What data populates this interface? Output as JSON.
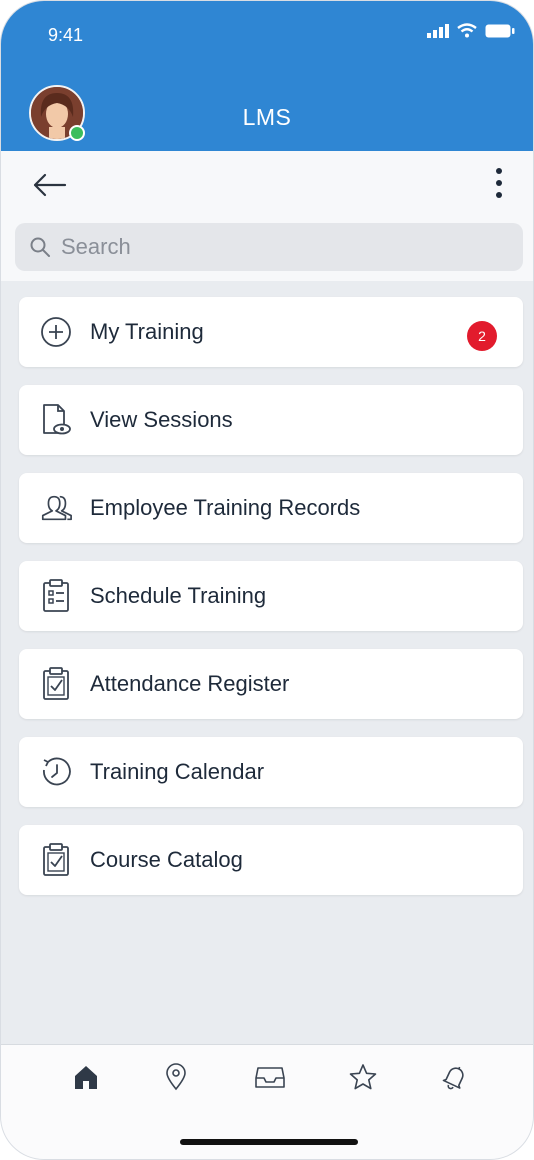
{
  "status_bar": {
    "time": "9:41"
  },
  "header": {
    "title": "LMS"
  },
  "search": {
    "placeholder": "Search"
  },
  "menu": {
    "items": [
      {
        "label": "My Training",
        "icon": "plus-circle-icon",
        "badge": "2"
      },
      {
        "label": "View Sessions",
        "icon": "document-eye-icon"
      },
      {
        "label": "Employee Training Records",
        "icon": "users-icon"
      },
      {
        "label": "Schedule Training",
        "icon": "clipboard-list-icon"
      },
      {
        "label": "Attendance Register",
        "icon": "clipboard-check-icon"
      },
      {
        "label": "Training Calendar",
        "icon": "clock-history-icon"
      },
      {
        "label": "Course Catalog",
        "icon": "clipboard-check-icon"
      }
    ]
  },
  "tabbar": {
    "tabs": [
      "home-icon",
      "location-pin-icon",
      "inbox-icon",
      "star-icon",
      "bell-icon"
    ],
    "active": "home-icon"
  },
  "colors": {
    "header": "#2f86d3",
    "badge": "#e21b2d",
    "text": "#1e2a3a"
  }
}
